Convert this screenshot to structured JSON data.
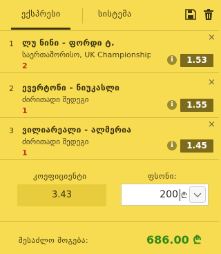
{
  "tabs": {
    "express_label": "ექსპრესი",
    "system_label": "სისტემა"
  },
  "bets": [
    {
      "index": "1",
      "title": "ლუ ნინი - ფორდი ტ.",
      "subtitle": "საერთაშორისო, UK Championship",
      "pick": "2",
      "odds": "1.53"
    },
    {
      "index": "2",
      "title": "ევერტონი - ნიუკასლი",
      "subtitle": "ძირითადი შედეგი",
      "pick": "1",
      "odds": "1.55"
    },
    {
      "index": "3",
      "title": "ვილიარეალი - ალმერია",
      "subtitle": "ძირითადი შედეგი",
      "pick": "1",
      "odds": "1.45"
    }
  ],
  "coefficient": {
    "label": "კოეფიციენტი",
    "value": "3.43"
  },
  "stake": {
    "label": "ფსონი:",
    "value": "200",
    "currency": "₾"
  },
  "win": {
    "label": "შესაძლო მოგება:",
    "value": "686.00 ₾"
  },
  "icons": {
    "info": "i",
    "close": "×"
  },
  "colors": {
    "background": "#f7dc52",
    "odds_bg": "#7d6b1c",
    "win": "#2f8a15",
    "pick": "#c4281b"
  }
}
